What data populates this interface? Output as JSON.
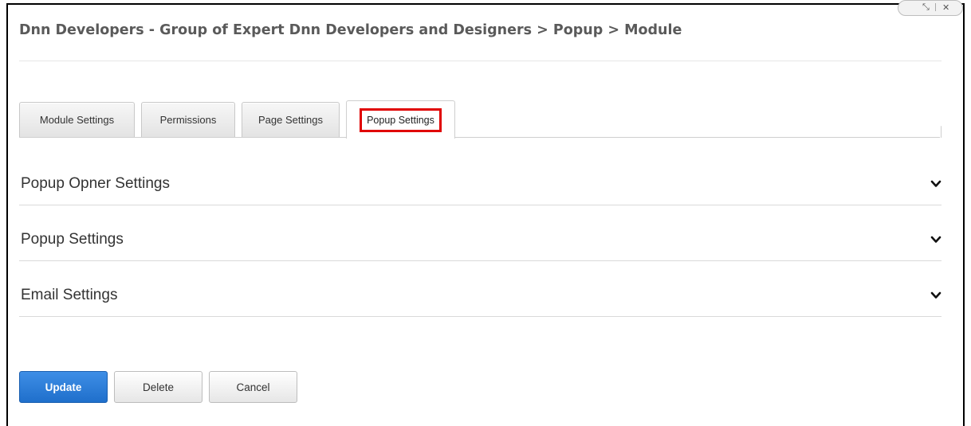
{
  "window": {
    "restore_icon": "restore-icon",
    "close_icon": "close-icon",
    "restore_glyph": "⤡",
    "close_glyph": "✕"
  },
  "header": {
    "breadcrumb_title": "Dnn Developers - Group of Expert Dnn Developers and Designers > Popup > Module"
  },
  "tabs": [
    {
      "label": "Module Settings",
      "active": false
    },
    {
      "label": "Permissions",
      "active": false
    },
    {
      "label": "Page Settings",
      "active": false
    },
    {
      "label": "Popup Settings",
      "active": true,
      "highlighted": true
    }
  ],
  "highlight_color": "#e00000",
  "sections": [
    {
      "label": "Popup Opner Settings",
      "icon": "chevron-down-icon"
    },
    {
      "label": "Popup Settings",
      "icon": "chevron-down-icon"
    },
    {
      "label": "Email Settings",
      "icon": "chevron-down-icon"
    }
  ],
  "actions": {
    "update_label": "Update",
    "delete_label": "Delete",
    "cancel_label": "Cancel",
    "primary_color": "#1f6fcb"
  }
}
